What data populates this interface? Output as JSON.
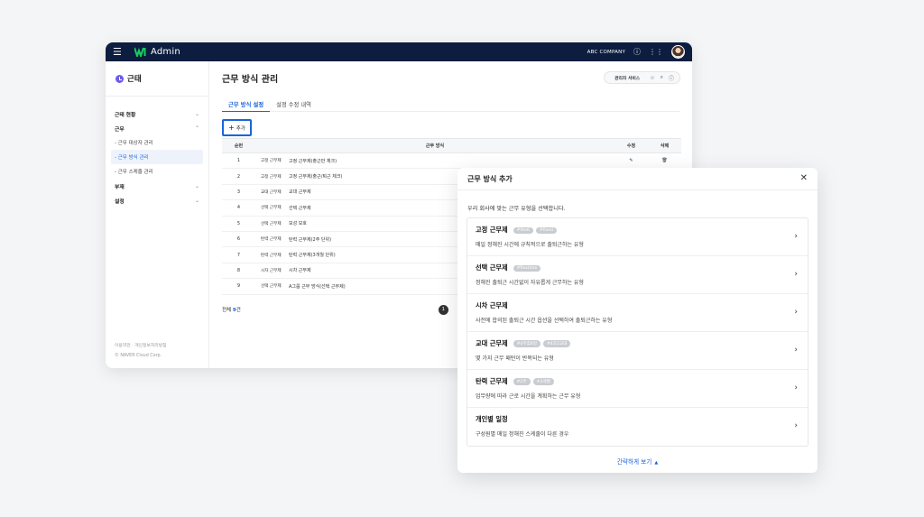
{
  "topbar": {
    "app_title": "Admin",
    "company": "ABC COMPANY"
  },
  "sidebar": {
    "title": "근태",
    "groups": [
      {
        "label": "근태 현황"
      },
      {
        "label": "근무"
      },
      {
        "label": "부재"
      },
      {
        "label": "설정"
      }
    ],
    "sub_items": [
      {
        "label": "- 근무 대상자 관리"
      },
      {
        "label": "- 근무 방식 관리"
      },
      {
        "label": "- 근무 스케줄 관리"
      }
    ],
    "footer_links": "이용약관 · 개인정보처리방침",
    "footer_copy": "© NAVER Cloud Corp."
  },
  "main": {
    "title": "근무 방식 관리",
    "toolbar_label": "관리자 서비스",
    "tabs": [
      {
        "label": "근무 방식 설정"
      },
      {
        "label": "설정 수정 내역"
      }
    ],
    "add_label": "추가",
    "table": {
      "headers": [
        "순번",
        "근무 방식",
        "수정",
        "삭제"
      ],
      "rows": [
        {
          "no": "1",
          "type": "고정 근무제",
          "name": "고정 근무제(출근만 체크)"
        },
        {
          "no": "2",
          "type": "고정 근무제",
          "name": "고정 근무제(출근/퇴근 체크)"
        },
        {
          "no": "3",
          "type": "교대 근무제",
          "name": "교대 근무제"
        },
        {
          "no": "4",
          "type": "선택 근무제",
          "name": "선택 근무제"
        },
        {
          "no": "5",
          "type": "선택 근무제",
          "name": "모성 보호"
        },
        {
          "no": "6",
          "type": "탄력 근무제",
          "name": "탄력 근무제(2주 단위)"
        },
        {
          "no": "7",
          "type": "탄력 근무제",
          "name": "탄력 근무제(3개월 단위)"
        },
        {
          "no": "8",
          "type": "시차 근무제",
          "name": "시차 근무제"
        },
        {
          "no": "9",
          "type": "선택 근무제",
          "name": "A그룹 근무 방식(선택 근무제)"
        }
      ]
    },
    "total_prefix": "전체 ",
    "total_count": "9",
    "total_suffix": "건",
    "page": "1"
  },
  "modal": {
    "title": "근무 방식 추가",
    "desc": "우리 회사에 맞는 근무 유형을 선택합니다.",
    "options": [
      {
        "title": "고정 근무제",
        "tags": [
          "#9to6",
          "#fixed"
        ],
        "desc": "매일 정해진 시간에 규칙적으로 출퇴근하는 유형"
      },
      {
        "title": "선택 근무제",
        "tags": [
          "#flextime"
        ],
        "desc": "정해진 출퇴근 시간없이 자유롭게 근무하는 유형"
      },
      {
        "title": "시차 근무제",
        "tags": [],
        "desc": "사전에 합의된 출퇴근 시간 옵션을 선택하여 출퇴근하는 유형"
      },
      {
        "title": "교대 근무제",
        "tags": [
          "#4주휴8일",
          "#4조2교대"
        ],
        "desc": "몇 가지 근무 패턴이 반복되는 유형"
      },
      {
        "title": "탄력 근무제",
        "tags": [
          "#2주",
          "#3개월"
        ],
        "desc": "업무량에 따라 근로 시간을 계획하는 근무 유형"
      },
      {
        "title": "개인별 일정",
        "tags": [],
        "desc": "구성원별 매일 정해진 스케줄이 다른 경우"
      }
    ],
    "footer_label": "간략하게 보기"
  }
}
